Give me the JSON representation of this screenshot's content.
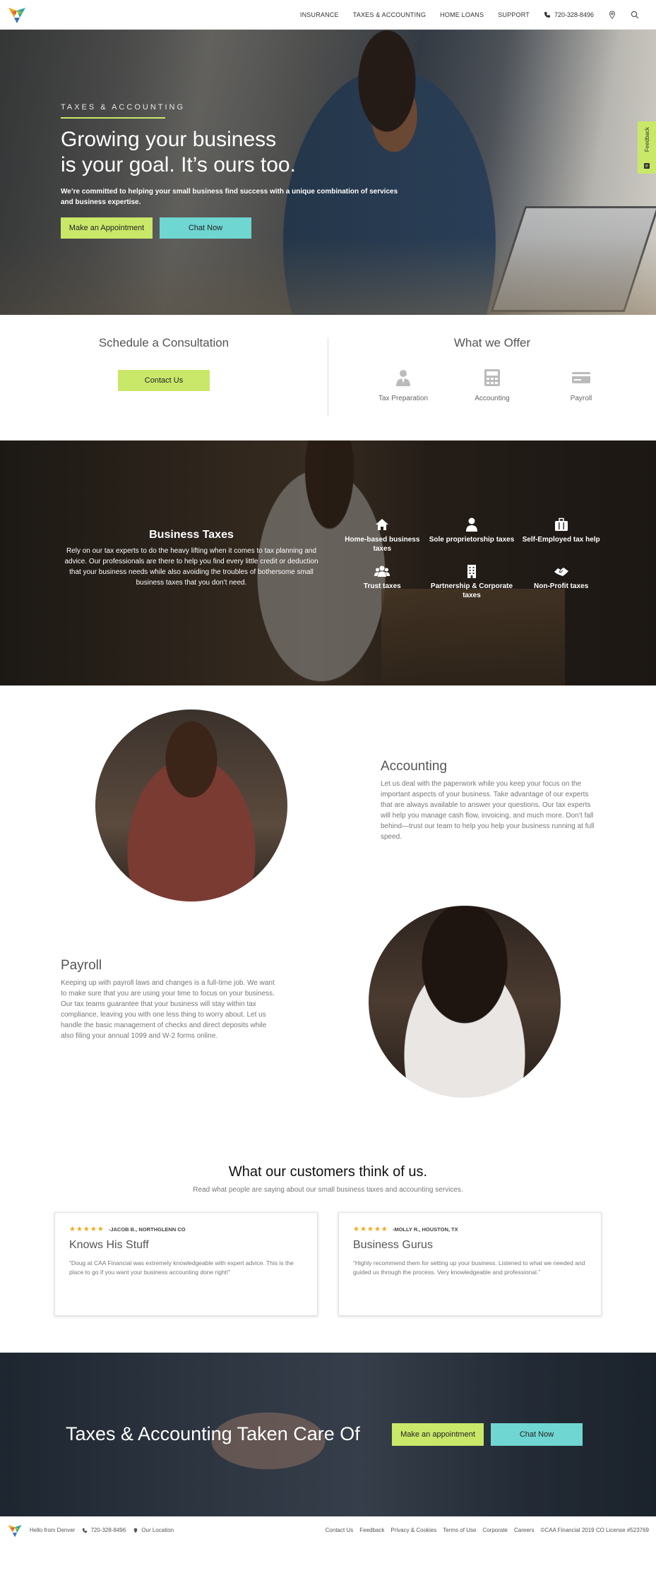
{
  "nav": {
    "links": [
      "INSURANCE",
      "TAXES & ACCOUNTING",
      "HOME LOANS",
      "SUPPORT"
    ],
    "phone": "720-328-8496"
  },
  "hero": {
    "eyebrow": "TAXES & ACCOUNTING",
    "title_line1": "Growing your business",
    "title_line2": "is your goal. It’s ours too.",
    "subtitle": "We’re committed to helping your small business find success with a unique combination of services and business expertise.",
    "appointment_label": "Make an Appointment",
    "chat_label": "Chat Now",
    "feedback_label": "Feedback"
  },
  "consult": {
    "title": "Schedule a Consultation",
    "contact_label": "Contact Us",
    "offer_title": "What we Offer",
    "offers": [
      {
        "label": "Tax Preparation",
        "icon": "user-icon"
      },
      {
        "label": "Accounting",
        "icon": "calculator-icon"
      },
      {
        "label": "Payroll",
        "icon": "check-card-icon"
      }
    ]
  },
  "business": {
    "title": "Business Taxes",
    "body": "Rely on our tax experts to do the heavy lifting when it comes to tax planning and advice. Our professionals are there to help you find every little credit or deduction that your business needs while also avoiding the troubles of bothersome small business taxes that you don’t need.",
    "items": [
      {
        "label": "Home-based business taxes",
        "icon": "home-icon"
      },
      {
        "label": "Sole proprietorship taxes",
        "icon": "person-icon"
      },
      {
        "label": "Self-Employed tax help",
        "icon": "briefcase-icon"
      },
      {
        "label": "Trust taxes",
        "icon": "group-icon"
      },
      {
        "label": "Partnership & Corporate taxes",
        "icon": "building-icon"
      },
      {
        "label": "Non-Profit taxes",
        "icon": "handshake-icon"
      }
    ]
  },
  "accounting": {
    "title": "Accounting",
    "body": "Let us deal with the paperwork while you keep your focus on the important aspects of your business. Take advantage of our experts that are always available to answer your questions. Our tax experts will help you manage cash flow, invoicing, and much more. Don’t fall behind—trust our team to help you help your business running at full speed."
  },
  "payroll": {
    "title": "Payroll",
    "body": "Keeping up with payroll laws and changes is a full-time job. We want to make sure that you are using your time to focus on your business. Our tax teams guarantee that your business will stay within tax compliance, leaving you with one less thing to worry about. Let us handle the basic management of checks and direct deposits while also filing your annual 1099 and W-2 forms online."
  },
  "testimonials": {
    "title": "What our customers think of us.",
    "subtitle": "Read what people are saying about our small business taxes and accounting services.",
    "cards": [
      {
        "stars": "★★★★★",
        "author": "-JACOB B., NORTHGLENN CO",
        "title": "Knows His Stuff",
        "quote": "“Doug at CAA Financial was extremely knowledgeable with expert advice. This is the place to go if you want your business accounting done right!”"
      },
      {
        "stars": "★★★★★",
        "author": "-MOLLY R., HOUSTON, TX",
        "title": "Business Gurus",
        "quote": "“Highly recommend them for setting up your business. Listened to what we needed and guided us through the process. Very knowledgeable and professional.”"
      }
    ]
  },
  "cta": {
    "title": "Taxes & Accounting Taken Care Of",
    "appointment_label": "Make an appointment",
    "chat_label": "Chat Now"
  },
  "footer": {
    "greeting": "Hello from Denver",
    "phone": "720-328-8496",
    "location": "Our Location",
    "links": [
      "Contact Us",
      "Feedback",
      "Privacy & Cookies",
      "Terms of Use",
      "Corporate",
      "Careers"
    ],
    "copyright": "©CAA Financial 2019 CO License #523769"
  },
  "colors": {
    "accent_green": "#c9e86a",
    "accent_teal": "#6fd6d2",
    "star": "#f2a81d"
  }
}
